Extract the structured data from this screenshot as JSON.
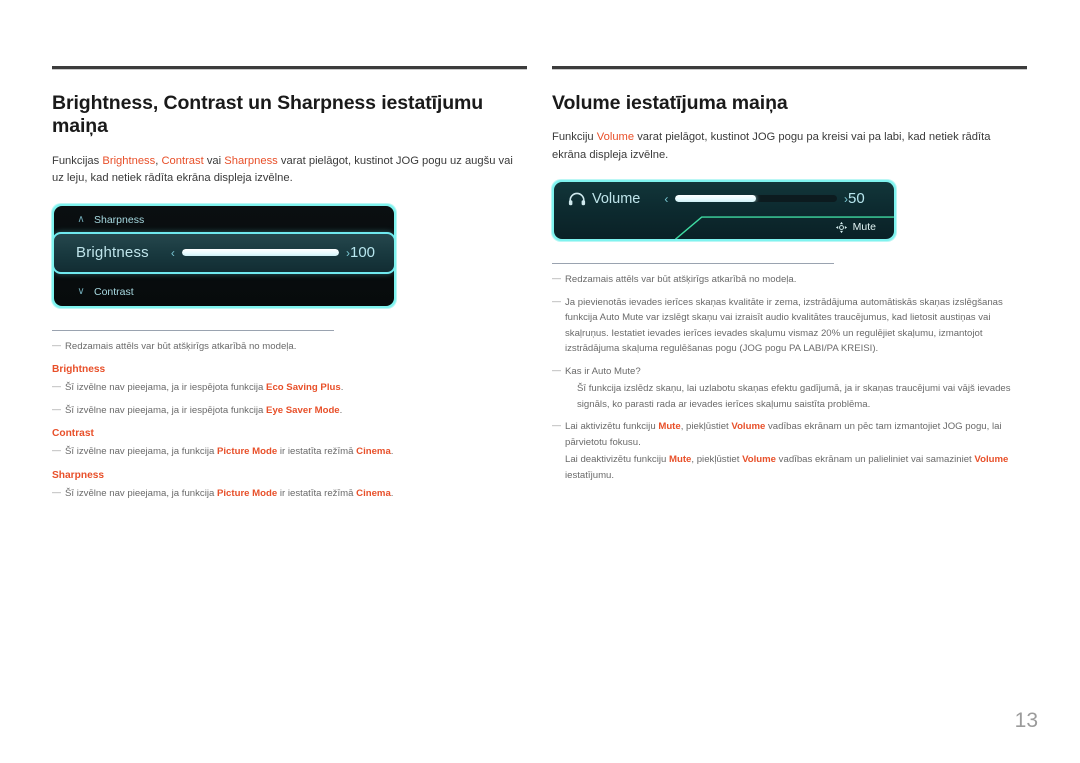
{
  "page": {
    "number": "13"
  },
  "left": {
    "title": "Brightness, Contrast un Sharpness iestatījumu maiņa",
    "intro": {
      "p1": "Funkcijas ",
      "k1": "Brightness",
      "p2": ", ",
      "k2": "Contrast",
      "p3": " vai ",
      "k3": "Sharpness",
      "p4": " varat pielāgot, kustinot JOG pogu uz augšu vai uz leju, kad netiek rādīta ekrāna displeja izvēlne."
    },
    "osd": {
      "row_top": {
        "label": "Sharpness",
        "chevron": "chevron-up-icon",
        "glyph": "∧"
      },
      "row_selected": {
        "label": "Brightness",
        "value": "100",
        "fill_percent": 100,
        "arrow_left": "‹",
        "arrow_right": "›"
      },
      "row_bottom": {
        "label": "Contrast",
        "chevron": "chevron-down-icon",
        "glyph": "∨"
      }
    },
    "notes": {
      "n1": "Redzamais attēls var būt atšķirīgs atkarībā no modeļa.",
      "h_brightness": "Brightness",
      "b1_a": "Šī izvēlne nav pieejama, ja ir iespējota funkcija ",
      "b1_k": "Eco Saving Plus",
      "b1_b": ".",
      "b2_a": "Šī izvēlne nav pieejama, ja ir iespējota funkcija ",
      "b2_k": "Eye Saver Mode",
      "b2_b": ".",
      "h_contrast": "Contrast",
      "c1_a": "Šī izvēlne nav pieejama, ja funkcija ",
      "c1_k1": "Picture Mode",
      "c1_b": " ir iestatīta režīmā ",
      "c1_k2": "Cinema",
      "c1_c": ".",
      "h_sharpness": "Sharpness",
      "s1_a": "Šī izvēlne nav pieejama, ja funkcija ",
      "s1_k1": "Picture Mode",
      "s1_b": " ir iestatīta režīmā ",
      "s1_k2": "Cinema",
      "s1_c": "."
    }
  },
  "right": {
    "title": "Volume iestatījuma maiņa",
    "intro": {
      "p1": "Funkciju ",
      "k1": "Volume",
      "p2": " varat pielāgot, kustinot JOG pogu pa kreisi vai pa labi, kad netiek rādīta ekrāna displeja izvēlne."
    },
    "osd": {
      "icon": "headphones-icon",
      "label": "Volume",
      "value": "50",
      "fill_percent": 50,
      "arrow_left": "‹",
      "arrow_right": "›",
      "mute_label": "Mute",
      "mute_icon": "jog-button-icon"
    },
    "notes": {
      "n1": "Redzamais attēls var būt atšķirīgs atkarībā no modeļa.",
      "n2": "Ja pievienotās ievades ierīces skaņas kvalitāte ir zema, izstrādājuma automātiskās skaņas izslēgšanas funkcija Auto Mute var izslēgt skaņu vai izraisīt audio kvalitātes traucējumus, kad lietosit austiņas vai skaļruņus. Iestatiet ievades ierīces ievades skaļumu vismaz 20% un regulējiet skaļumu, izmantojot izstrādājuma skaļuma regulēšanas pogu (JOG pogu PA LABI/PA KREISI).",
      "n3": "Kas ir Auto Mute?",
      "n3_sub": "Šī funkcija izslēdz skaņu, lai uzlabotu skaņas efektu gadījumā, ja ir skaņas traucējumi vai vājš ievades signāls, ko parasti rada ar ievades ierīces skaļumu saistīta problēma.",
      "n4_a": "Lai aktivizētu funkciju ",
      "n4_k1": "Mute",
      "n4_b": ", piekļūstiet ",
      "n4_k2": "Volume",
      "n4_c": " vadības ekrānam un pēc tam izmantojiet JOG pogu, lai pārvietotu fokusu.",
      "n5_a": "Lai deaktivizētu funkciju ",
      "n5_k1": "Mute",
      "n5_b": ", piekļūstiet ",
      "n5_k2": "Volume",
      "n5_c": " vadības ekrānam un palieliniet vai samaziniet ",
      "n5_k3": "Volume",
      "n5_d": " iestatījumu."
    }
  },
  "colors": {
    "accent_orange": "#e8502a",
    "osd_border_cyan": "#6fe9ef",
    "osd_text_cyan": "#bfe4ea",
    "osd_bg_dark": "#0a0f11",
    "volume_bg": "#12363a",
    "mute_green": "#37d6a0"
  }
}
